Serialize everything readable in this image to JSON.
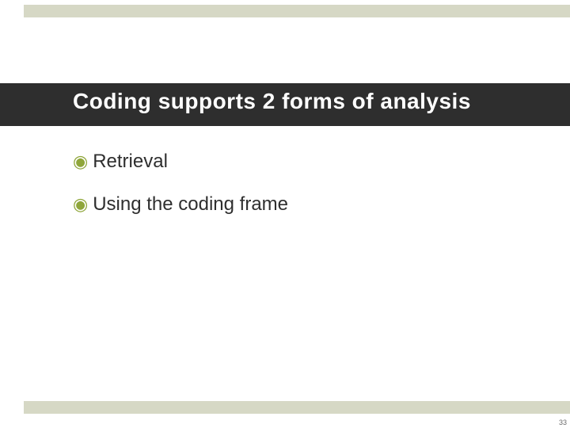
{
  "title": "Coding supports 2 forms of analysis",
  "bullets": [
    {
      "text": "Retrieval"
    },
    {
      "text": "Using the coding frame"
    }
  ],
  "page_number": "33",
  "colors": {
    "accent_bar": "#d6d8c5",
    "title_band": "#2e2e2e",
    "bullet_icon": "#8fa63a"
  }
}
